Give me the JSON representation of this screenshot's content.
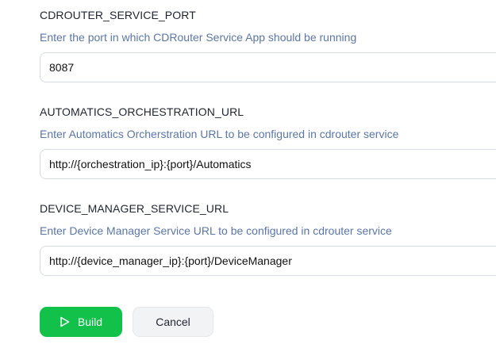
{
  "fields": [
    {
      "label": "CDROUTER_SERVICE_PORT",
      "help": "Enter the port in which CDRouter Service App should be running",
      "value": "8087"
    },
    {
      "label": "AUTOMATICS_ORCHESTRATION_URL",
      "help": "Enter Automatics Orcherstration URL to be configured in cdrouter service",
      "value": "http://{orchestration_ip}:{port}/Automatics"
    },
    {
      "label": "DEVICE_MANAGER_SERVICE_URL",
      "help": "Enter Device Manager Service URL to be configured in cdrouter service",
      "value": "http://{device_manager_ip}:{port}/DeviceManager"
    }
  ],
  "actions": {
    "build_label": "Build",
    "build_icon": "play-icon",
    "cancel_label": "Cancel",
    "build_color": "#11c14a"
  }
}
